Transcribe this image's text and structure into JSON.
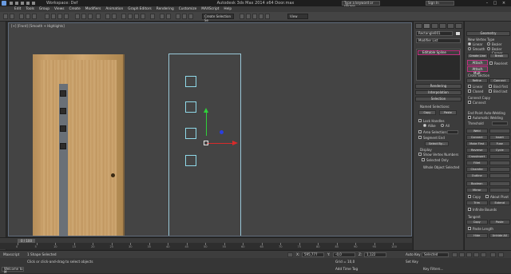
{
  "title_bar": {
    "workspace_label": "Workspace: Def",
    "window_title": "Autodesk 3ds Max  2014 x64    Door.max",
    "search_placeholder": "Type a keyword or phrase",
    "sign_in": "Sign In"
  },
  "menu": [
    "Edit",
    "Tools",
    "Group",
    "Views",
    "Create",
    "Modifiers",
    "Animation",
    "Graph Editors",
    "Rendering",
    "Customize",
    "MAXScript",
    "Help"
  ],
  "toolbar": {
    "selection_set": "Create Selection Se",
    "ref_coord": "View"
  },
  "viewport": {
    "label": "[+] [Front] [Smooth + Highlights]"
  },
  "timeline": {
    "frame_indicator": "0 / 100",
    "ticks": [
      "0",
      "5",
      "10",
      "15",
      "20",
      "25",
      "30",
      "35",
      "40",
      "45",
      "50",
      "55",
      "60",
      "65",
      "70",
      "75",
      "80",
      "85",
      "90",
      "95",
      "100"
    ]
  },
  "status": {
    "script_label": "Maxscript",
    "selection_info": "1 Shape Selected",
    "prompt": "Click or click-and-drag to select objects",
    "x_label": "X:",
    "x_value": "595,777",
    "y_label": "Y:",
    "y_value": "-0,0",
    "z_label": "Z:",
    "z_value": "1,122",
    "grid_label": "Grid = 10,0",
    "addtime_label": "Add Time Tag",
    "autokey_label": "Auto Key",
    "autokey_value": "Selected",
    "setkey_label": "Set Key",
    "keyfilters_label": "Key Filters...",
    "welcome": "Welcome to M"
  },
  "command_panel": {
    "object_name": "Rectangle001",
    "modifier_list": "Modifier List",
    "stack_item": "Editable Spline",
    "rollouts": [
      "Rendering",
      "Interpolation",
      "Selection"
    ],
    "named_selections": "Named Selections:",
    "copy_btn": "Copy",
    "paste_btn": "Paste",
    "lock_handles": "Lock Handles",
    "alike": "Alike",
    "all": "All",
    "area_selection": "Area Selection:",
    "segment_end": "Segment End",
    "select_by": "Select By...",
    "display": "Display",
    "show_vertex_numbers": "Show Vertex Numbers",
    "selected_only": "Selected Only",
    "whole_object_selected": "Whole Object Selected"
  },
  "geometry_panel": {
    "header": "Geometry",
    "new_vertex_type": "New Vertex Type",
    "linear": "Linear",
    "bezier": "Bezier",
    "smooth": "Smooth",
    "bezier_corner": "Bezier Corner",
    "create_line": "Create Line",
    "break": "Break",
    "attach": "Attach",
    "reorient": "Reorient",
    "attach_mult": "Attach Mult.",
    "cross_section": "Cross Section",
    "refine": "Refine",
    "connect": "Connect",
    "linear2": "Linear",
    "bind_first": "Bind first",
    "closed": "Closed",
    "bind_last": "Bind last",
    "connect_copy": "Connect Copy",
    "connect_chk": "Connect",
    "end_point_auto_welding": "End Point Auto-Welding",
    "automatic_welding": "Automatic Welding",
    "threshold": "Threshold",
    "weld": "Weld",
    "connect2": "Connect",
    "insert": "Insert",
    "make_first": "Make First",
    "fuse": "Fuse",
    "reverse": "Reverse",
    "cycle": "Cycle",
    "crossinsert": "CrossInsert",
    "fillet": "Fillet",
    "chamfer": "Chamfer",
    "outline": "Outline",
    "boolean": "Boolean",
    "mirror": "Mirror",
    "copy": "Copy",
    "about_pivot": "About Pivot",
    "trim": "Trim",
    "extend": "Extend",
    "infinite_bounds": "Infinite Bounds",
    "tangent": "Tangent",
    "copy2": "Copy",
    "paste2": "Paste",
    "paste_length": "Paste Length",
    "hide": "Hide",
    "unhide_all": "Unhide All"
  },
  "colors": {
    "accent_selected": "#c03080",
    "gizmo_x": "#d82a2a",
    "gizmo_y": "#2fd23a",
    "gizmo_z": "#2a3ee0",
    "wire": "#8fd8e8"
  },
  "icons": [
    "app-icon",
    "undo-icon",
    "redo-icon",
    "gizmo-x-axis",
    "gizmo-y-axis",
    "gizmo-z-axis"
  ]
}
